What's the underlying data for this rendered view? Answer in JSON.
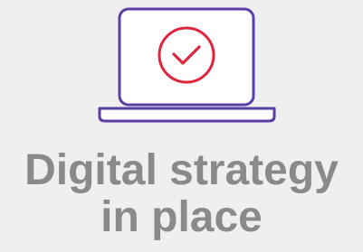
{
  "icon": {
    "device": "laptop-icon",
    "mark": "checkmark-circle-icon",
    "colors": {
      "laptop": "#5b3ea6",
      "check": "#e0253f",
      "screen": "#ffffff"
    }
  },
  "caption": {
    "line1": "Digital strategy",
    "line2": "in place",
    "color": "#8a8a8a"
  }
}
